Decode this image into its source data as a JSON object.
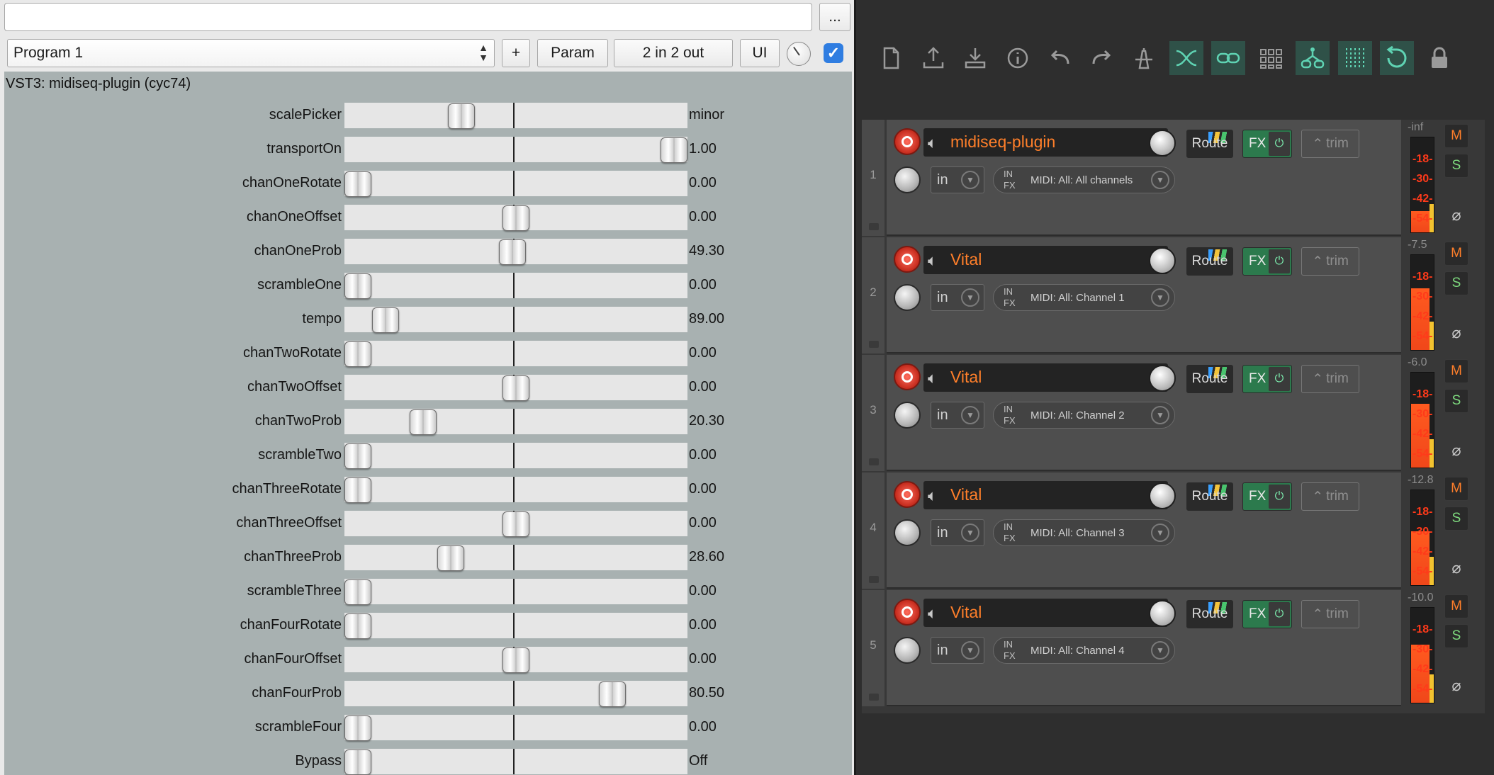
{
  "plugin": {
    "preset_field": "",
    "more_label": "...",
    "program": "Program 1",
    "add_label": "+",
    "param_label": "Param",
    "io_label": "2 in 2 out",
    "ui_label": "UI",
    "title": "VST3: midiseq-plugin (cyc74)",
    "params": [
      {
        "name": "scalePicker",
        "value": "minor",
        "pos": 0.34
      },
      {
        "name": "transportOn",
        "value": "1.00",
        "pos": 0.96
      },
      {
        "name": "chanOneRotate",
        "value": "0.00",
        "pos": 0.04
      },
      {
        "name": "chanOneOffset",
        "value": "0.00",
        "pos": 0.5
      },
      {
        "name": "chanOneProb",
        "value": "49.30",
        "pos": 0.49
      },
      {
        "name": "scrambleOne",
        "value": "0.00",
        "pos": 0.04
      },
      {
        "name": "tempo",
        "value": "89.00",
        "pos": 0.12
      },
      {
        "name": "chanTwoRotate",
        "value": "0.00",
        "pos": 0.04
      },
      {
        "name": "chanTwoOffset",
        "value": "0.00",
        "pos": 0.5
      },
      {
        "name": "chanTwoProb",
        "value": "20.30",
        "pos": 0.23
      },
      {
        "name": "scrambleTwo",
        "value": "0.00",
        "pos": 0.04
      },
      {
        "name": "chanThreeRotate",
        "value": "0.00",
        "pos": 0.04
      },
      {
        "name": "chanThreeOffset",
        "value": "0.00",
        "pos": 0.5
      },
      {
        "name": "chanThreeProb",
        "value": "28.60",
        "pos": 0.31
      },
      {
        "name": "scrambleThree",
        "value": "0.00",
        "pos": 0.04
      },
      {
        "name": "chanFourRotate",
        "value": "0.00",
        "pos": 0.04
      },
      {
        "name": "chanFourOffset",
        "value": "0.00",
        "pos": 0.5
      },
      {
        "name": "chanFourProb",
        "value": "80.50",
        "pos": 0.78
      },
      {
        "name": "scrambleFour",
        "value": "0.00",
        "pos": 0.04
      },
      {
        "name": "Bypass",
        "value": "Off",
        "pos": 0.04
      }
    ]
  },
  "toolbar": {
    "icons": [
      "new-file-icon",
      "upload-icon",
      "download-icon",
      "info-icon",
      "undo-icon",
      "redo-icon",
      "metronome-icon",
      "crossfade-icon",
      "link-icon",
      "grid-icon",
      "routing-icon",
      "snap-grid-icon",
      "loop-icon",
      "lock-icon"
    ]
  },
  "tracks": [
    {
      "num": "1",
      "name": "midiseq-plugin",
      "route": "Route",
      "fx": "FX",
      "trim": "trim",
      "in": "in",
      "in_label": "IN\nFX",
      "midi": "MIDI: All: All channels",
      "peak": "-inf",
      "level": 0.22,
      "m": "M",
      "s": "S",
      "ticks": [
        "-18-",
        "-30-",
        "-42-",
        "-54-"
      ]
    },
    {
      "num": "2",
      "name": "Vital",
      "route": "Route",
      "fx": "FX",
      "trim": "trim",
      "in": "in",
      "in_label": "IN\nFX",
      "midi": "MIDI: All: Channel 1",
      "peak": "-7.5",
      "level": 0.64,
      "m": "M",
      "s": "S",
      "ticks": [
        "-18-",
        "-30-",
        "-42-",
        "-54-"
      ]
    },
    {
      "num": "3",
      "name": "Vital",
      "route": "Route",
      "fx": "FX",
      "trim": "trim",
      "in": "in",
      "in_label": "IN\nFX",
      "midi": "MIDI: All: Channel 2",
      "peak": "-6.0",
      "level": 0.66,
      "m": "M",
      "s": "S",
      "ticks": [
        "-18-",
        "-30-",
        "-42-",
        "-54-"
      ]
    },
    {
      "num": "4",
      "name": "Vital",
      "route": "Route",
      "fx": "FX",
      "trim": "trim",
      "in": "in",
      "in_label": "IN\nFX",
      "midi": "MIDI: All: Channel 3",
      "peak": "-12.8",
      "level": 0.56,
      "m": "M",
      "s": "S",
      "ticks": [
        "-18-",
        "-30-",
        "-42-",
        "-54-"
      ]
    },
    {
      "num": "5",
      "name": "Vital",
      "route": "Route",
      "fx": "FX",
      "trim": "trim",
      "in": "in",
      "in_label": "IN\nFX",
      "midi": "MIDI: All: Channel 4",
      "peak": "-10.0",
      "level": 0.6,
      "m": "M",
      "s": "S",
      "ticks": [
        "-18-",
        "-30-",
        "-42-",
        "-54-"
      ]
    }
  ]
}
